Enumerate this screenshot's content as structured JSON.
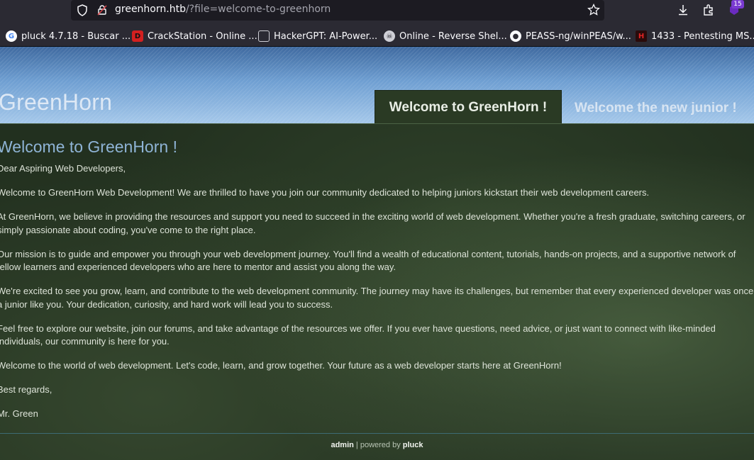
{
  "browser": {
    "url_host": "greenhorn.htb",
    "url_path": "/?file=welcome-to-greenhorn",
    "extension_badge": "15",
    "bookmarks": [
      {
        "label": "pluck 4.7.18 - Buscar ...",
        "icon": "google-icon"
      },
      {
        "label": "CrackStation - Online ...",
        "icon": "crackstation-icon"
      },
      {
        "label": "HackerGPT: AI-Power...",
        "icon": "hackergpt-icon"
      },
      {
        "label": "Online - Reverse Shel...",
        "icon": "skull-icon"
      },
      {
        "label": "PEASS-ng/winPEAS/w...",
        "icon": "github-icon"
      },
      {
        "label": "1433 - Pentesting MS...",
        "icon": "hacktricks-icon"
      }
    ]
  },
  "site": {
    "title": "GreenHorn",
    "tabs": [
      "Welcome to GreenHorn !",
      "Welcome the new junior !"
    ]
  },
  "main": {
    "heading": "Welcome to GreenHorn !",
    "paragraphs": [
      "Dear Aspiring Web Developers,",
      "Welcome to GreenHorn Web Development! We are thrilled to have you join our community dedicated to helping juniors kickstart their web development careers.",
      "At GreenHorn, we believe in providing the resources and support you need to succeed in the exciting world of web development. Whether you're a fresh graduate, switching careers, or simply passionate about coding, you've come to the right place.",
      "Our mission is to guide and empower you through your web development journey. You'll find a wealth of educational content, tutorials, hands-on projects, and a supportive network of fellow learners and experienced developers who are here to mentor and assist you along the way.",
      "We're excited to see you grow, learn, and contribute to the web development community. The journey may have its challenges, but remember that every experienced developer was once a junior like you. Your dedication, curiosity, and hard work will lead you to success.",
      "Feel free to explore our website, join our forums, and take advantage of the resources we offer. If you ever have questions, need advice, or just want to connect with like-minded individuals, our community is here for you.",
      "Welcome to the world of web development. Let's code, learn, and grow together. Your future as a web developer starts here at GreenHorn!",
      "Best regards,",
      "Mr. Green"
    ]
  },
  "footer": {
    "admin_label": "admin",
    "separator": " | powered by ",
    "pluck_label": "pluck"
  },
  "colors": {
    "header_top": "#3f6aa0",
    "header_bottom": "#a5c8ea",
    "heading": "#8fb4d6",
    "body_bg": "#22301f"
  }
}
